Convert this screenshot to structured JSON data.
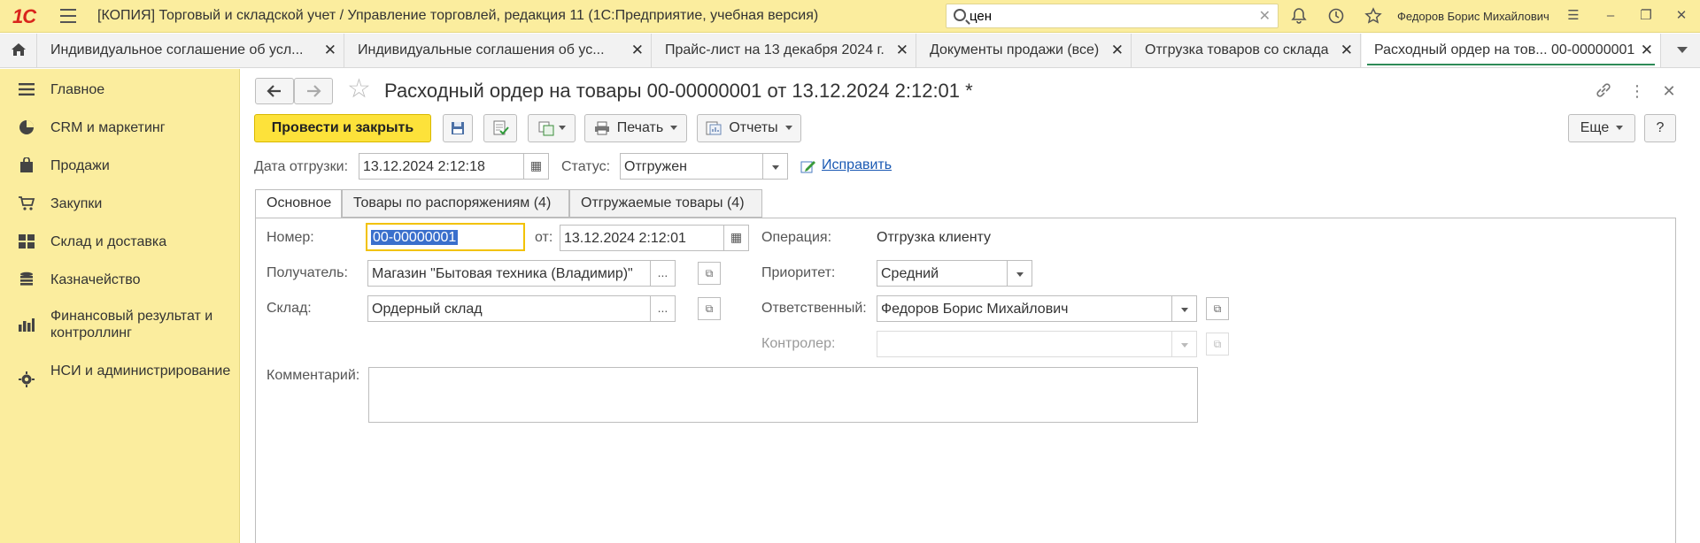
{
  "titlebar": {
    "logo": "1С",
    "app_title": "[КОПИЯ] Торговый и складской учет / Управление торговлей, редакция 11  (1С:Предприятие, учебная версия)",
    "search_value": "цен",
    "user_name": "Федоров Борис Михайлович"
  },
  "tabs": [
    {
      "label": "Индивидуальное соглашение об усл..."
    },
    {
      "label": "Индивидуальные соглашения об ус..."
    },
    {
      "label": "Прайс-лист на 13 декабря 2024 г."
    },
    {
      "label": "Документы продажи (все)"
    },
    {
      "label": "Отгрузка товаров со склада"
    },
    {
      "label": "Расходный ордер на тов... 00-00000001",
      "active": true
    }
  ],
  "sidebar": {
    "items": [
      {
        "label": "Главное",
        "icon": "menu-lines-icon"
      },
      {
        "label": "CRM и маркетинг",
        "icon": "pie-chart-icon"
      },
      {
        "label": "Продажи",
        "icon": "shopping-bag-icon"
      },
      {
        "label": "Закупки",
        "icon": "cart-icon"
      },
      {
        "label": "Склад и доставка",
        "icon": "warehouse-grid-icon"
      },
      {
        "label": "Казначейство",
        "icon": "coins-icon"
      },
      {
        "label": "Финансовый результат и контроллинг",
        "icon": "bar-chart-icon"
      },
      {
        "label": "НСИ и администрирование",
        "icon": "gear-icon"
      }
    ]
  },
  "form": {
    "title": "Расходный ордер на товары 00-00000001 от 13.12.2024 2:12:01 *",
    "toolbar": {
      "post_and_close": "Провести и закрыть",
      "print": "Печать",
      "reports": "Отчеты",
      "more": "Еще",
      "help": "?"
    },
    "shipment_date_label": "Дата отгрузки:",
    "shipment_date": "13.12.2024  2:12:18",
    "status_label": "Статус:",
    "status": "Отгружен",
    "fix_link": "Исправить",
    "tabs": [
      "Основное",
      "Товары по распоряжениям (4)",
      "Отгружаемые товары (4)"
    ],
    "number_label": "Номер:",
    "number": "00-00000001",
    "from_label": "от:",
    "from_date": "13.12.2024  2:12:01",
    "operation_label": "Операция:",
    "operation": "Отгрузка клиенту",
    "recipient_label": "Получатель:",
    "recipient": "Магазин \"Бытовая техника (Владимир)\"",
    "priority_label": "Приоритет:",
    "priority": "Средний",
    "warehouse_label": "Склад:",
    "warehouse": "Ордерный склад",
    "responsible_label": "Ответственный:",
    "responsible": "Федоров Борис Михайлович",
    "controller_label": "Контролер:",
    "controller": "",
    "comment_label": "Комментарий:",
    "comment": ""
  },
  "colors": {
    "sidebar_bg": "#fbed9e",
    "primary_button": "#fde23a",
    "link": "#1a59b3",
    "active_tab_underline": "#2e8b57"
  }
}
